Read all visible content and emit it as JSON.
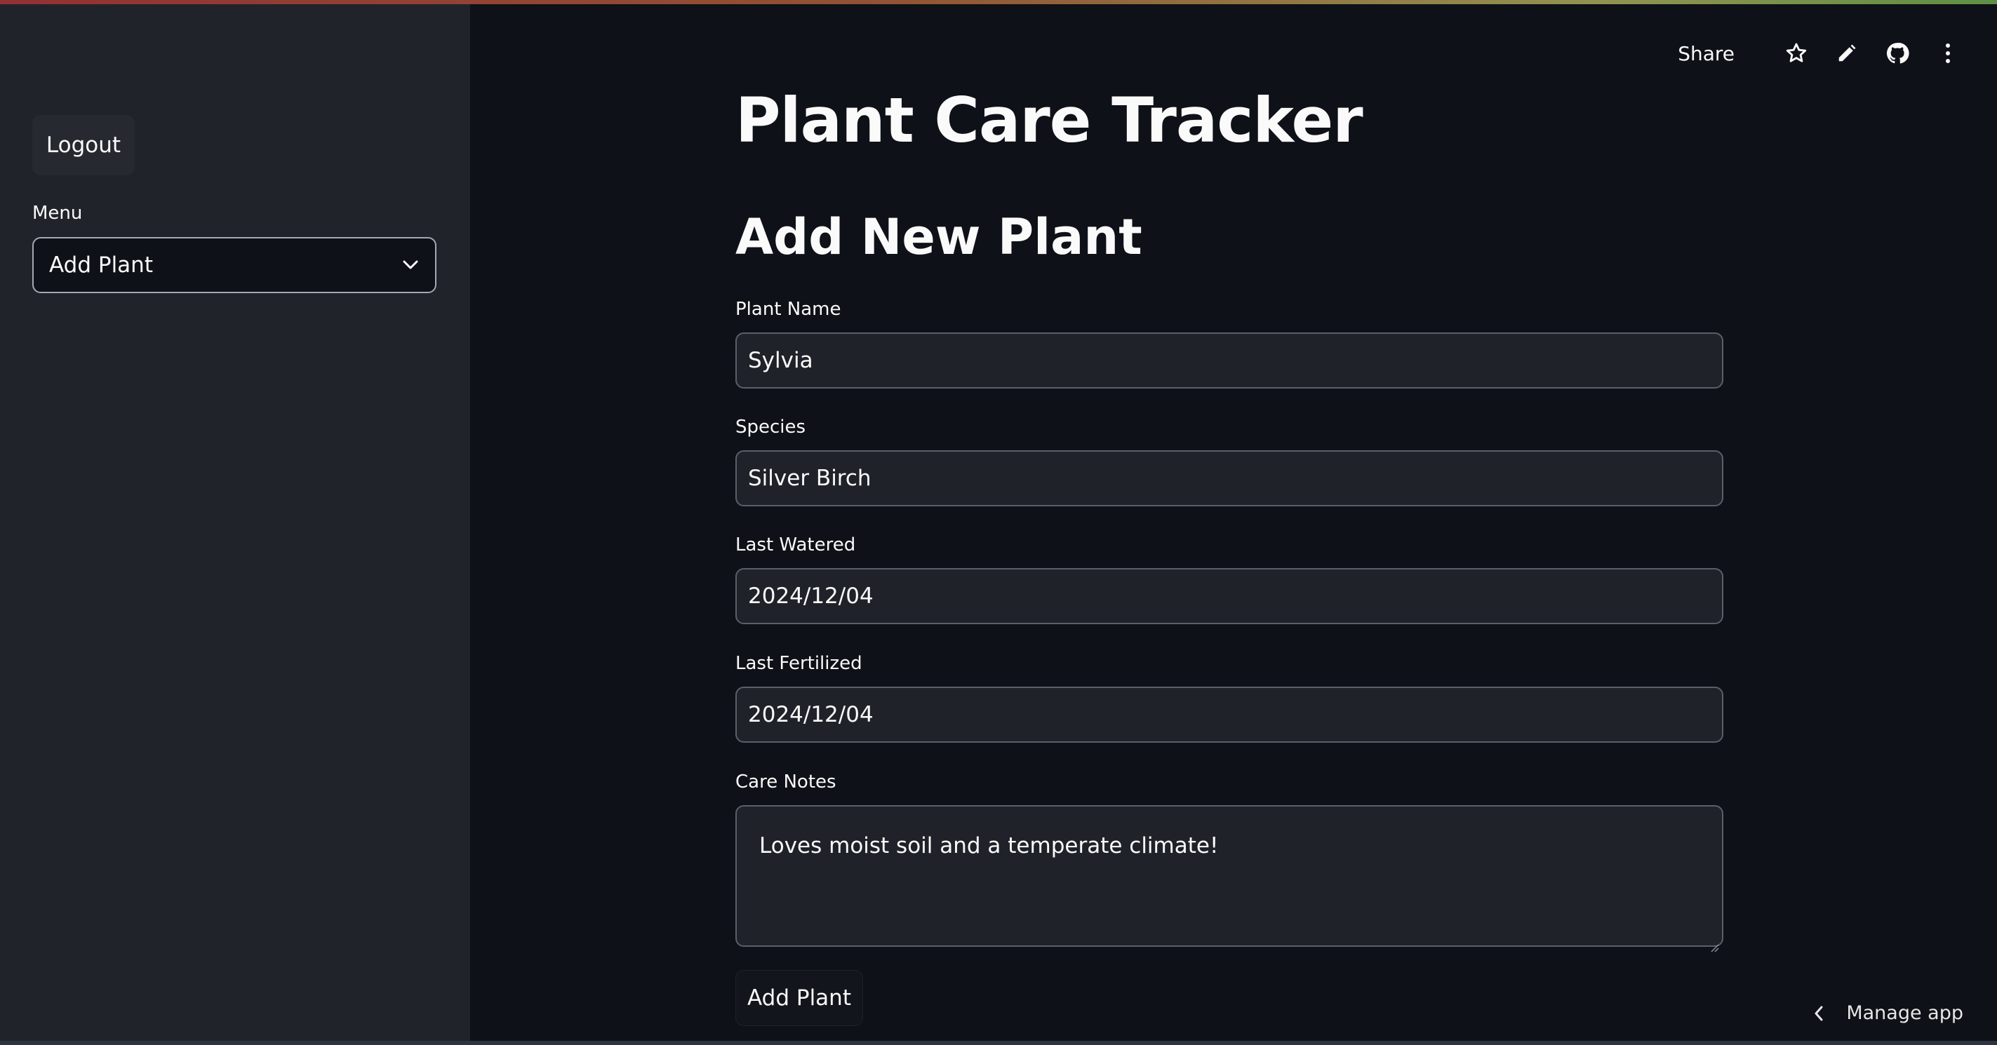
{
  "sidebar": {
    "logout_label": "Logout",
    "menu_label": "Menu",
    "menu_selected": "Add Plant"
  },
  "toolbar": {
    "share_label": "Share",
    "icons": [
      "star-icon",
      "pencil-icon",
      "github-icon",
      "more-vertical-icon"
    ]
  },
  "main": {
    "title": "Plant Care Tracker",
    "section_title": "Add New Plant",
    "fields": {
      "plant_name": {
        "label": "Plant Name",
        "value": "Sylvia"
      },
      "species": {
        "label": "Species",
        "value": "Silver Birch"
      },
      "last_watered": {
        "label": "Last Watered",
        "value": "2024/12/04"
      },
      "last_fertilized": {
        "label": "Last Fertilized",
        "value": "2024/12/04"
      },
      "care_notes": {
        "label": "Care Notes",
        "value": "Loves moist soil and a temperate climate!"
      }
    },
    "submit_label": "Add Plant"
  },
  "footer": {
    "manage_app_label": "Manage app"
  },
  "colors": {
    "background": "#0e1117",
    "sidebar": "#20242a",
    "input_background": "#1f2329",
    "text": "#fafafa"
  }
}
